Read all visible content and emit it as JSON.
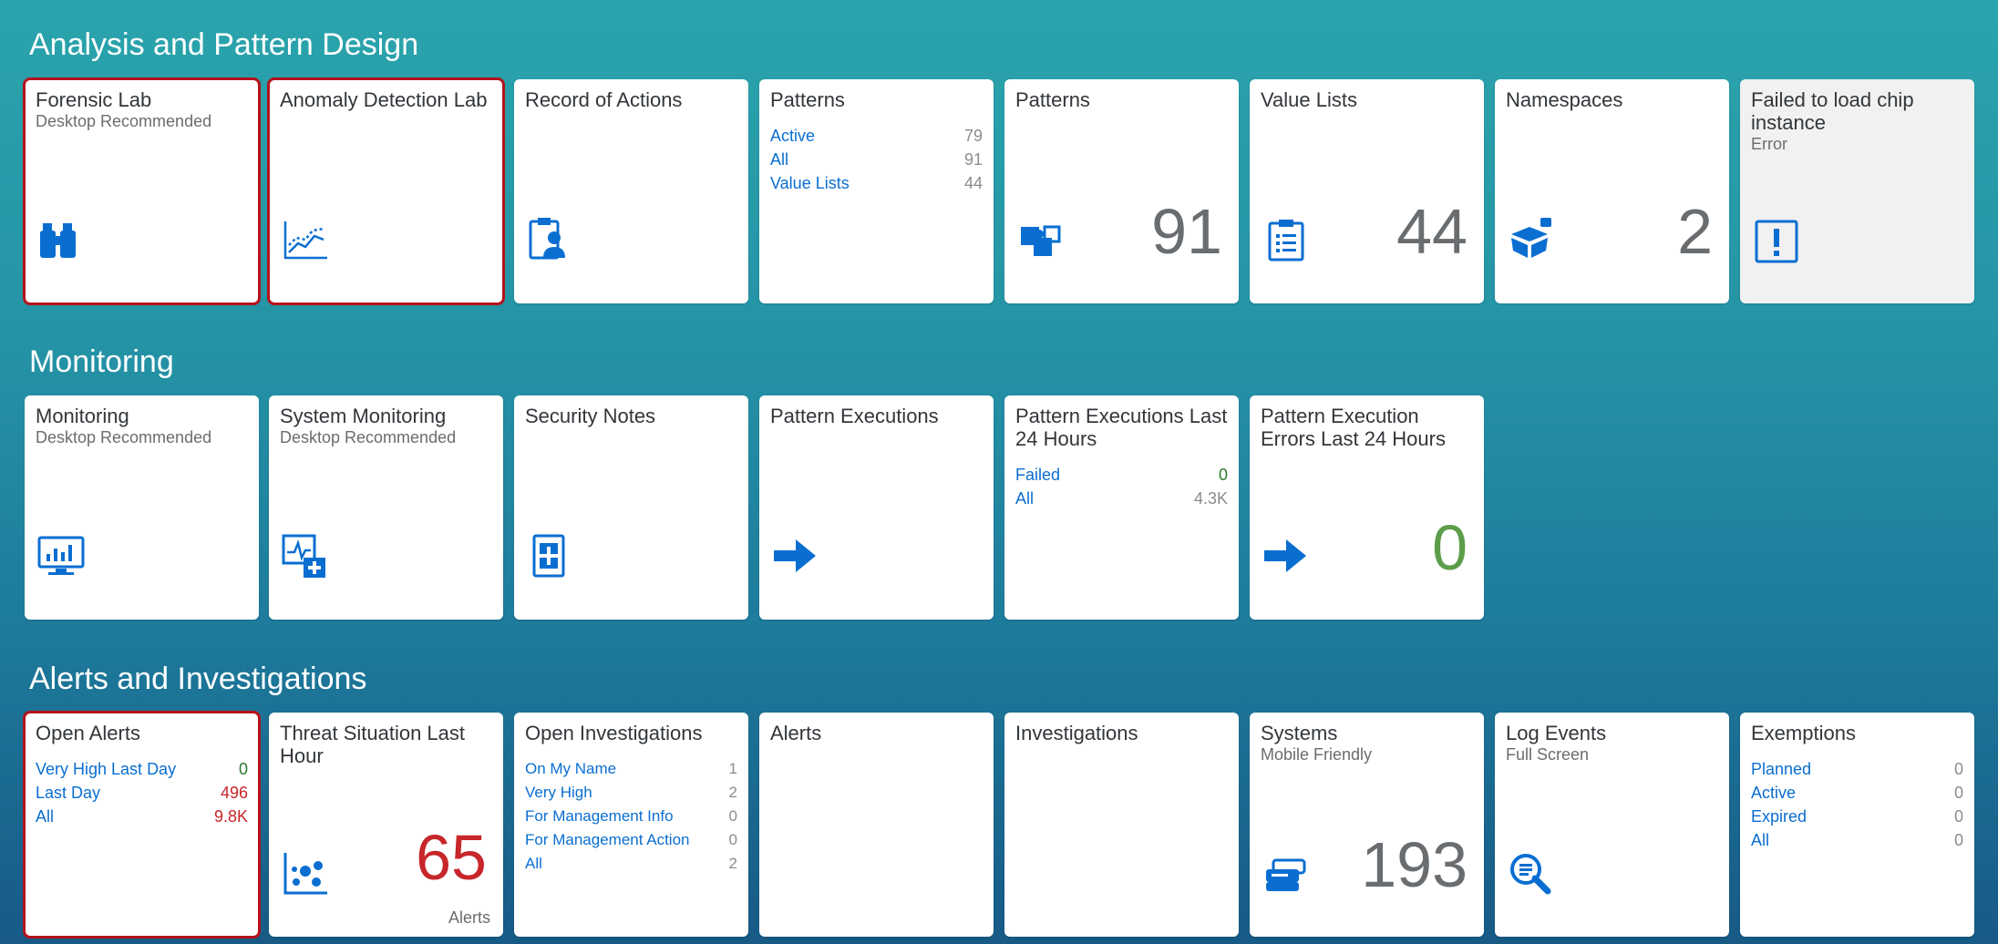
{
  "sections": {
    "analysis": "Analysis and Pattern Design",
    "monitoring": "Monitoring",
    "alerts": "Alerts and Investigations"
  },
  "tiles": {
    "forensic_lab": {
      "title": "Forensic Lab",
      "subtitle": "Desktop Recommended",
      "icon": "binoculars-icon"
    },
    "anomaly_lab": {
      "title": "Anomaly Detection Lab",
      "icon": "line-chart-icon"
    },
    "record_actions": {
      "title": "Record of Actions",
      "icon": "clipboard-user-icon"
    },
    "patterns_list": {
      "title": "Patterns",
      "rows": [
        {
          "label": "Active",
          "value": "79"
        },
        {
          "label": "All",
          "value": "91"
        },
        {
          "label": "Value Lists",
          "value": "44"
        }
      ]
    },
    "patterns_count": {
      "title": "Patterns",
      "value": "91",
      "icon": "puzzle-icon"
    },
    "value_lists": {
      "title": "Value Lists",
      "value": "44",
      "icon": "list-clipboard-icon"
    },
    "namespaces": {
      "title": "Namespaces",
      "value": "2",
      "icon": "box-icon"
    },
    "failed_chip": {
      "title": "Failed to load chip instance",
      "subtitle": "Error",
      "icon": "warning-icon"
    },
    "monitoring": {
      "title": "Monitoring",
      "subtitle": "Desktop Recommended",
      "icon": "monitor-chart-icon"
    },
    "system_monitoring": {
      "title": "System Monitoring",
      "subtitle": "Desktop Recommended",
      "icon": "activity-add-icon"
    },
    "security_notes": {
      "title": "Security Notes",
      "icon": "document-add-icon"
    },
    "pattern_executions": {
      "title": "Pattern Executions",
      "icon": "arrow-right-icon"
    },
    "pattern_exec_24": {
      "title": "Pattern Executions Last 24 Hours",
      "rows": [
        {
          "label": "Failed",
          "value": "0"
        },
        {
          "label": "All",
          "value": "4.3K"
        }
      ]
    },
    "pattern_exec_err_24": {
      "title": "Pattern Execution Errors Last 24 Hours",
      "value": "0",
      "icon": "arrow-right-icon"
    },
    "open_alerts": {
      "title": "Open Alerts",
      "rows": [
        {
          "label": "Very High Last Day",
          "value": "0"
        },
        {
          "label": "Last Day",
          "value": "496"
        },
        {
          "label": "All",
          "value": "9.8K"
        }
      ]
    },
    "threat_situation": {
      "title": "Threat Situation Last Hour",
      "value": "65",
      "footer": "Alerts",
      "icon": "scatter-chart-icon"
    },
    "open_investigations": {
      "title": "Open Investigations",
      "rows": [
        {
          "label": "On My Name",
          "value": "1"
        },
        {
          "label": "Very High",
          "value": "2"
        },
        {
          "label": "For Management Info",
          "value": "0"
        },
        {
          "label": "For Management Action",
          "value": "0"
        },
        {
          "label": "All",
          "value": "2"
        }
      ]
    },
    "alerts": {
      "title": "Alerts"
    },
    "investigations": {
      "title": "Investigations"
    },
    "systems": {
      "title": "Systems",
      "subtitle": "Mobile Friendly",
      "value": "193",
      "icon": "servers-icon"
    },
    "log_events": {
      "title": "Log Events",
      "subtitle": "Full Screen",
      "icon": "search-log-icon"
    },
    "exemptions": {
      "title": "Exemptions",
      "rows": [
        {
          "label": "Planned",
          "value": "0"
        },
        {
          "label": "Active",
          "value": "0"
        },
        {
          "label": "Expired",
          "value": "0"
        },
        {
          "label": "All",
          "value": "0"
        }
      ]
    }
  },
  "colors": {
    "accent": "#0a6ed1",
    "selected_outline": "#b5121b",
    "good": "#5d9d4a",
    "bad": "#c7262b"
  }
}
